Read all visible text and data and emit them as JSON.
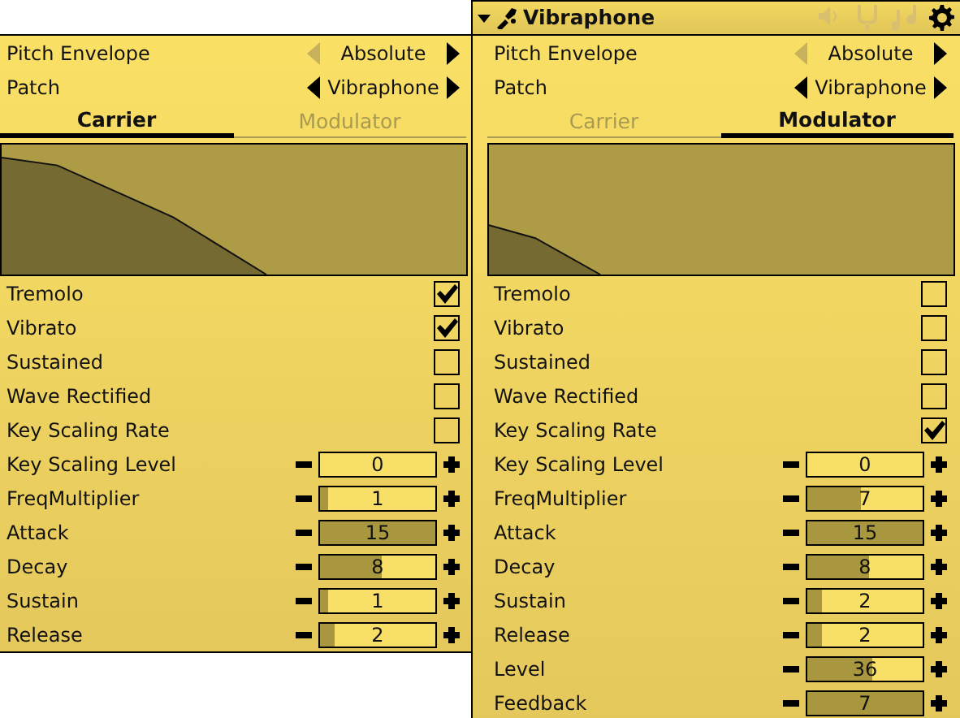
{
  "panels": [
    {
      "selectors": [
        {
          "label": "Pitch Envelope",
          "value": "Absolute",
          "prev_enabled": false,
          "next_enabled": true
        },
        {
          "label": "Patch",
          "value": "Vibraphone",
          "prev_enabled": true,
          "next_enabled": true
        }
      ],
      "tabs": [
        {
          "label": "Carrier",
          "selected": true
        },
        {
          "label": "Modulator",
          "selected": false
        }
      ],
      "rows": [
        {
          "kind": "checkbox",
          "label": "Tremolo",
          "checked": true
        },
        {
          "kind": "checkbox",
          "label": "Vibrato",
          "checked": true
        },
        {
          "kind": "checkbox",
          "label": "Sustained",
          "checked": false
        },
        {
          "kind": "checkbox",
          "label": "Wave Rectified",
          "checked": false
        },
        {
          "kind": "checkbox",
          "label": "Key Scaling Rate",
          "checked": false
        },
        {
          "kind": "spin",
          "label": "Key Scaling Level",
          "value": "0",
          "level": 0
        },
        {
          "kind": "spin",
          "label": "FreqMultiplier",
          "value": "1",
          "level": 0.07
        },
        {
          "kind": "spin",
          "label": "Attack",
          "value": "15",
          "level": 1
        },
        {
          "kind": "spin",
          "label": "Decay",
          "value": "8",
          "level": 0.53
        },
        {
          "kind": "spin",
          "label": "Sustain",
          "value": "1",
          "level": 0.07
        },
        {
          "kind": "spin",
          "label": "Release",
          "value": "2",
          "level": 0.13
        }
      ]
    },
    {
      "header": {
        "title": "Vibraphone",
        "icons": [
          {
            "kind": "speaker",
            "enabled": false
          },
          {
            "kind": "fork",
            "enabled": false
          },
          {
            "kind": "notes",
            "enabled": false
          },
          {
            "kind": "gear",
            "enabled": true
          }
        ]
      },
      "selectors": [
        {
          "label": "Pitch Envelope",
          "value": "Absolute",
          "prev_enabled": false,
          "next_enabled": true
        },
        {
          "label": "Patch",
          "value": "Vibraphone",
          "prev_enabled": true,
          "next_enabled": true
        }
      ],
      "tabs": [
        {
          "label": "Carrier",
          "selected": false
        },
        {
          "label": "Modulator",
          "selected": true
        }
      ],
      "rows": [
        {
          "kind": "checkbox",
          "label": "Tremolo",
          "checked": false
        },
        {
          "kind": "checkbox",
          "label": "Vibrato",
          "checked": false
        },
        {
          "kind": "checkbox",
          "label": "Sustained",
          "checked": false
        },
        {
          "kind": "checkbox",
          "label": "Wave Rectified",
          "checked": false
        },
        {
          "kind": "checkbox",
          "label": "Key Scaling Rate",
          "checked": true
        },
        {
          "kind": "spin",
          "label": "Key Scaling Level",
          "value": "0",
          "level": 0
        },
        {
          "kind": "spin",
          "label": "FreqMultiplier",
          "value": "7",
          "level": 0.47
        },
        {
          "kind": "spin",
          "label": "Attack",
          "value": "15",
          "level": 1
        },
        {
          "kind": "spin",
          "label": "Decay",
          "value": "8",
          "level": 0.53
        },
        {
          "kind": "spin",
          "label": "Sustain",
          "value": "2",
          "level": 0.13
        },
        {
          "kind": "spin",
          "label": "Release",
          "value": "2",
          "level": 0.13
        },
        {
          "kind": "spin",
          "label": "Level",
          "value": "36",
          "level": 0.57
        },
        {
          "kind": "spin",
          "label": "Feedback",
          "value": "7",
          "level": 1
        }
      ]
    }
  ]
}
